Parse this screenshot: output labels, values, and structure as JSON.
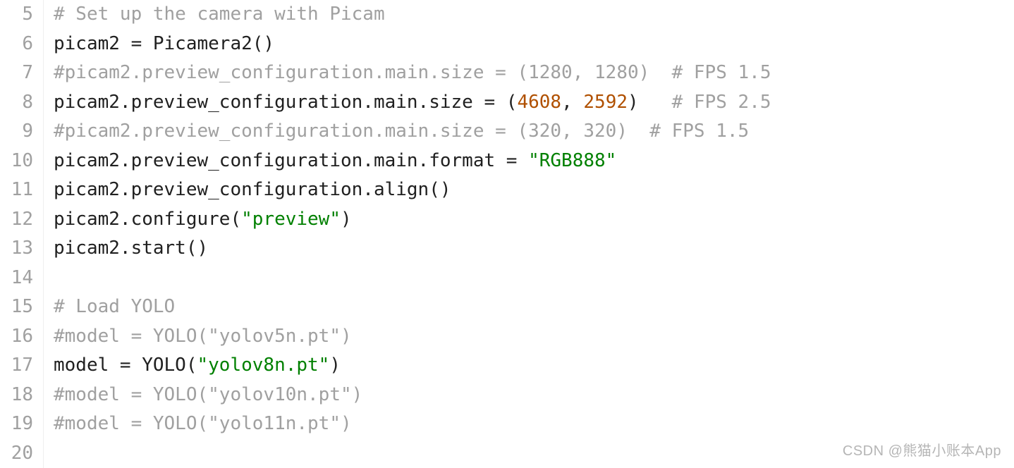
{
  "lines": [
    {
      "num": 5,
      "tokens": [
        {
          "cls": "comment",
          "t": "# Set up the camera with Picam"
        }
      ]
    },
    {
      "num": 6,
      "tokens": [
        {
          "cls": "",
          "t": "picam2 = Picamera2()"
        }
      ]
    },
    {
      "num": 7,
      "tokens": [
        {
          "cls": "comment",
          "t": "#picam2.preview_configuration.main.size = (1280, 1280)  # FPS 1.5"
        }
      ]
    },
    {
      "num": 8,
      "tokens": [
        {
          "cls": "",
          "t": "picam2.preview_configuration.main.size = ("
        },
        {
          "cls": "number",
          "t": "4608"
        },
        {
          "cls": "",
          "t": ", "
        },
        {
          "cls": "number",
          "t": "2592"
        },
        {
          "cls": "",
          "t": ")   "
        },
        {
          "cls": "comment",
          "t": "# FPS 2.5"
        }
      ]
    },
    {
      "num": 9,
      "tokens": [
        {
          "cls": "comment",
          "t": "#picam2.preview_configuration.main.size = (320, 320)  # FPS 1.5"
        }
      ]
    },
    {
      "num": 10,
      "tokens": [
        {
          "cls": "",
          "t": "picam2.preview_configuration.main.format = "
        },
        {
          "cls": "string",
          "t": "\"RGB888\""
        }
      ]
    },
    {
      "num": 11,
      "tokens": [
        {
          "cls": "",
          "t": "picam2.preview_configuration.align()"
        }
      ]
    },
    {
      "num": 12,
      "tokens": [
        {
          "cls": "",
          "t": "picam2.configure("
        },
        {
          "cls": "string",
          "t": "\"preview\""
        },
        {
          "cls": "",
          "t": ")"
        }
      ]
    },
    {
      "num": 13,
      "tokens": [
        {
          "cls": "",
          "t": "picam2.start()"
        }
      ]
    },
    {
      "num": 14,
      "tokens": []
    },
    {
      "num": 15,
      "tokens": [
        {
          "cls": "comment",
          "t": "# Load YOLO"
        }
      ]
    },
    {
      "num": 16,
      "tokens": [
        {
          "cls": "comment",
          "t": "#model = YOLO(\"yolov5n.pt\")"
        }
      ]
    },
    {
      "num": 17,
      "tokens": [
        {
          "cls": "",
          "t": "model = YOLO("
        },
        {
          "cls": "string",
          "t": "\"yolov8n.pt\""
        },
        {
          "cls": "",
          "t": ")"
        }
      ]
    },
    {
      "num": 18,
      "tokens": [
        {
          "cls": "comment",
          "t": "#model = YOLO(\"yolov10n.pt\")"
        }
      ]
    },
    {
      "num": 19,
      "tokens": [
        {
          "cls": "comment",
          "t": "#model = YOLO(\"yolo11n.pt\")"
        }
      ]
    },
    {
      "num": 20,
      "tokens": []
    }
  ],
  "watermark": "CSDN @熊猫小账本App"
}
